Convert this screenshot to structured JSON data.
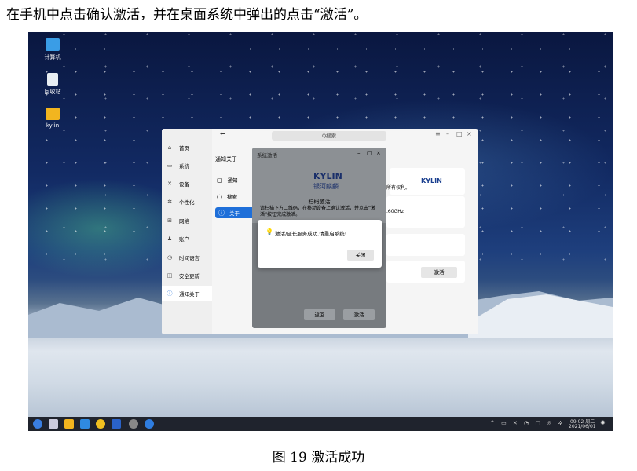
{
  "instruction": "在手机中点击确认激活，并在桌面系统中弹出的点击“激活”。",
  "caption": "图  19  激活成功",
  "desktop_icons": [
    {
      "label": "计算机",
      "icon": "computer-icon",
      "color": "#3a9de6"
    },
    {
      "label": "回收站",
      "icon": "recycle-bin-icon",
      "color": "#e8eef3"
    },
    {
      "label": "kylin",
      "icon": "folder-icon",
      "color": "#f2b51f"
    }
  ],
  "settings": {
    "search_placeholder": "Q搜索",
    "back_glyph": "←",
    "window_controls": [
      "≡",
      "–",
      "□",
      "×"
    ],
    "page_title": "通知关于",
    "nav": [
      {
        "label": "首页",
        "glyph": "⌂"
      },
      {
        "label": "系统",
        "glyph": "▭"
      },
      {
        "label": "设备",
        "glyph": "✕"
      },
      {
        "label": "个性化",
        "glyph": "✲"
      },
      {
        "label": "网络",
        "glyph": "⊞"
      },
      {
        "label": "账户",
        "glyph": "♟"
      },
      {
        "label": "时间语言",
        "glyph": "◷"
      },
      {
        "label": "安全更新",
        "glyph": "◫"
      },
      {
        "label": "通知关于",
        "glyph": "ⓘ"
      }
    ],
    "subnav": [
      {
        "label": "通知",
        "glyph": "▢"
      },
      {
        "label": "搜索",
        "glyph": "○"
      },
      {
        "label": "关于",
        "glyph": "ⓘ"
      }
    ],
    "rights_text": "所有权利。",
    "cpu_text": ".60GHz",
    "activate_button": "激活"
  },
  "activation_dialog": {
    "title": "系统激活",
    "window_controls": [
      "–",
      "□",
      "×"
    ],
    "brand": "KYLIN",
    "brand_cn": "银河麒麟",
    "heading": "扫码激活",
    "body": "请扫描下方二维码，在移动设备上确认激活，并点击“激活”按钮完成激活。",
    "back_button": "返回",
    "activate_button": "激活"
  },
  "message_box": {
    "text": "激活/延长服务成功,请重启系统!",
    "close_button": "关闭"
  },
  "taskbar": {
    "time": "09:02 周二",
    "date": "2021/06/01"
  }
}
